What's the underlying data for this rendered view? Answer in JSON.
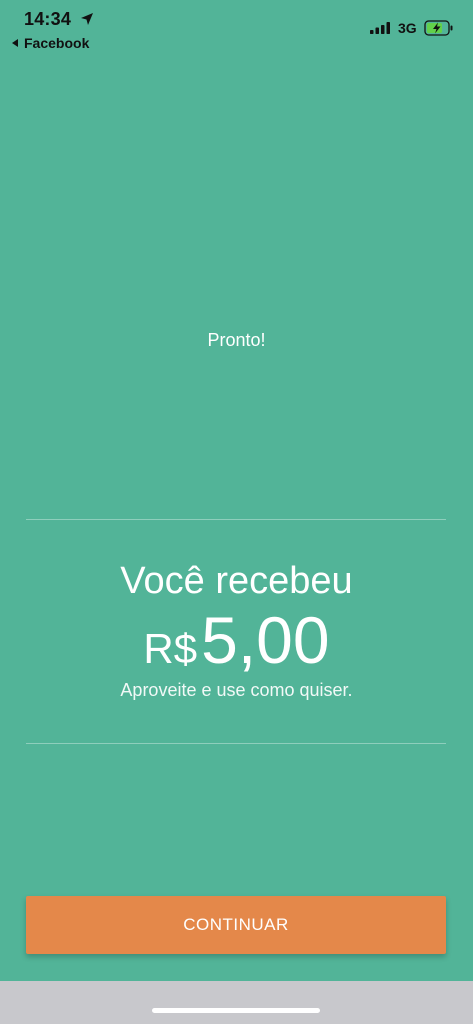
{
  "status_bar": {
    "time": "14:34",
    "back_app_label": "Facebook",
    "network": "3G",
    "icons": [
      "location-arrow-icon",
      "back-triangle-icon",
      "signal-bars-icon",
      "battery-charging-icon"
    ]
  },
  "main": {
    "status_text": "Pronto!",
    "title": "Você recebeu",
    "currency": "R$",
    "amount": "5,00",
    "subtitle": "Aproveite e use como quiser."
  },
  "button": {
    "label": "CONTINUAR"
  },
  "colors": {
    "background": "#52B498",
    "button": "#E4884A",
    "battery_fill": "#62D04A",
    "home_bar_area": "#C8C8CC"
  }
}
